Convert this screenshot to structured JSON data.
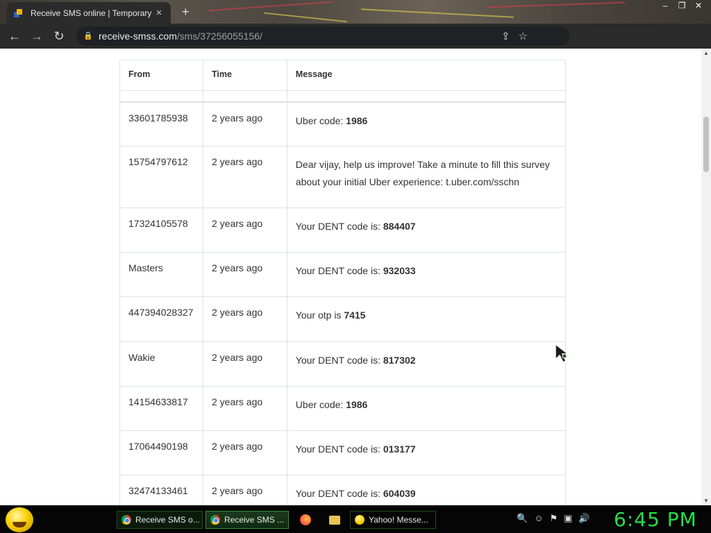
{
  "browser": {
    "tab_title": "Receive SMS online | Temporary",
    "tab_close": "×",
    "new_tab": "+",
    "url_domain": "receive-smss.com",
    "url_path": "/sms/37256055156/"
  },
  "table": {
    "headers": [
      "From",
      "Time",
      "Message"
    ],
    "rows": [
      {
        "from": "33601785938",
        "time": "2 years ago",
        "msg_prefix": "Uber code: ",
        "msg_code": "1986"
      },
      {
        "from": "15754797612",
        "time": "2 years ago",
        "msg_prefix": "Dear vijay, help us improve! Take a minute to fill this survey about your initial Uber experience: t.uber.com/sschn",
        "msg_code": ""
      },
      {
        "from": "17324105578",
        "time": "2 years ago",
        "msg_prefix": "Your DENT code is: ",
        "msg_code": "884407"
      },
      {
        "from": "Masters",
        "time": "2 years ago",
        "msg_prefix": "Your DENT code is: ",
        "msg_code": "932033"
      },
      {
        "from": "447394028327",
        "time": "2 years ago",
        "msg_prefix": "Your otp is ",
        "msg_code": "7415"
      },
      {
        "from": "Wakie",
        "time": "2 years ago",
        "msg_prefix": "Your DENT code is: ",
        "msg_code": "817302"
      },
      {
        "from": "14154633817",
        "time": "2 years ago",
        "msg_prefix": "Uber code: ",
        "msg_code": "1986"
      },
      {
        "from": "17064490198",
        "time": "2 years ago",
        "msg_prefix": "Your DENT code is: ",
        "msg_code": "013177"
      },
      {
        "from": "32474133461",
        "time": "2 years ago",
        "msg_prefix": "Your DENT code is: ",
        "msg_code": "604039"
      }
    ]
  },
  "taskbar": {
    "items": [
      {
        "label": "Receive SMS o..."
      },
      {
        "label": "Receive SMS ..."
      },
      {
        "label": "Yahoo! Messe..."
      }
    ],
    "clock": "6:45 PM"
  }
}
